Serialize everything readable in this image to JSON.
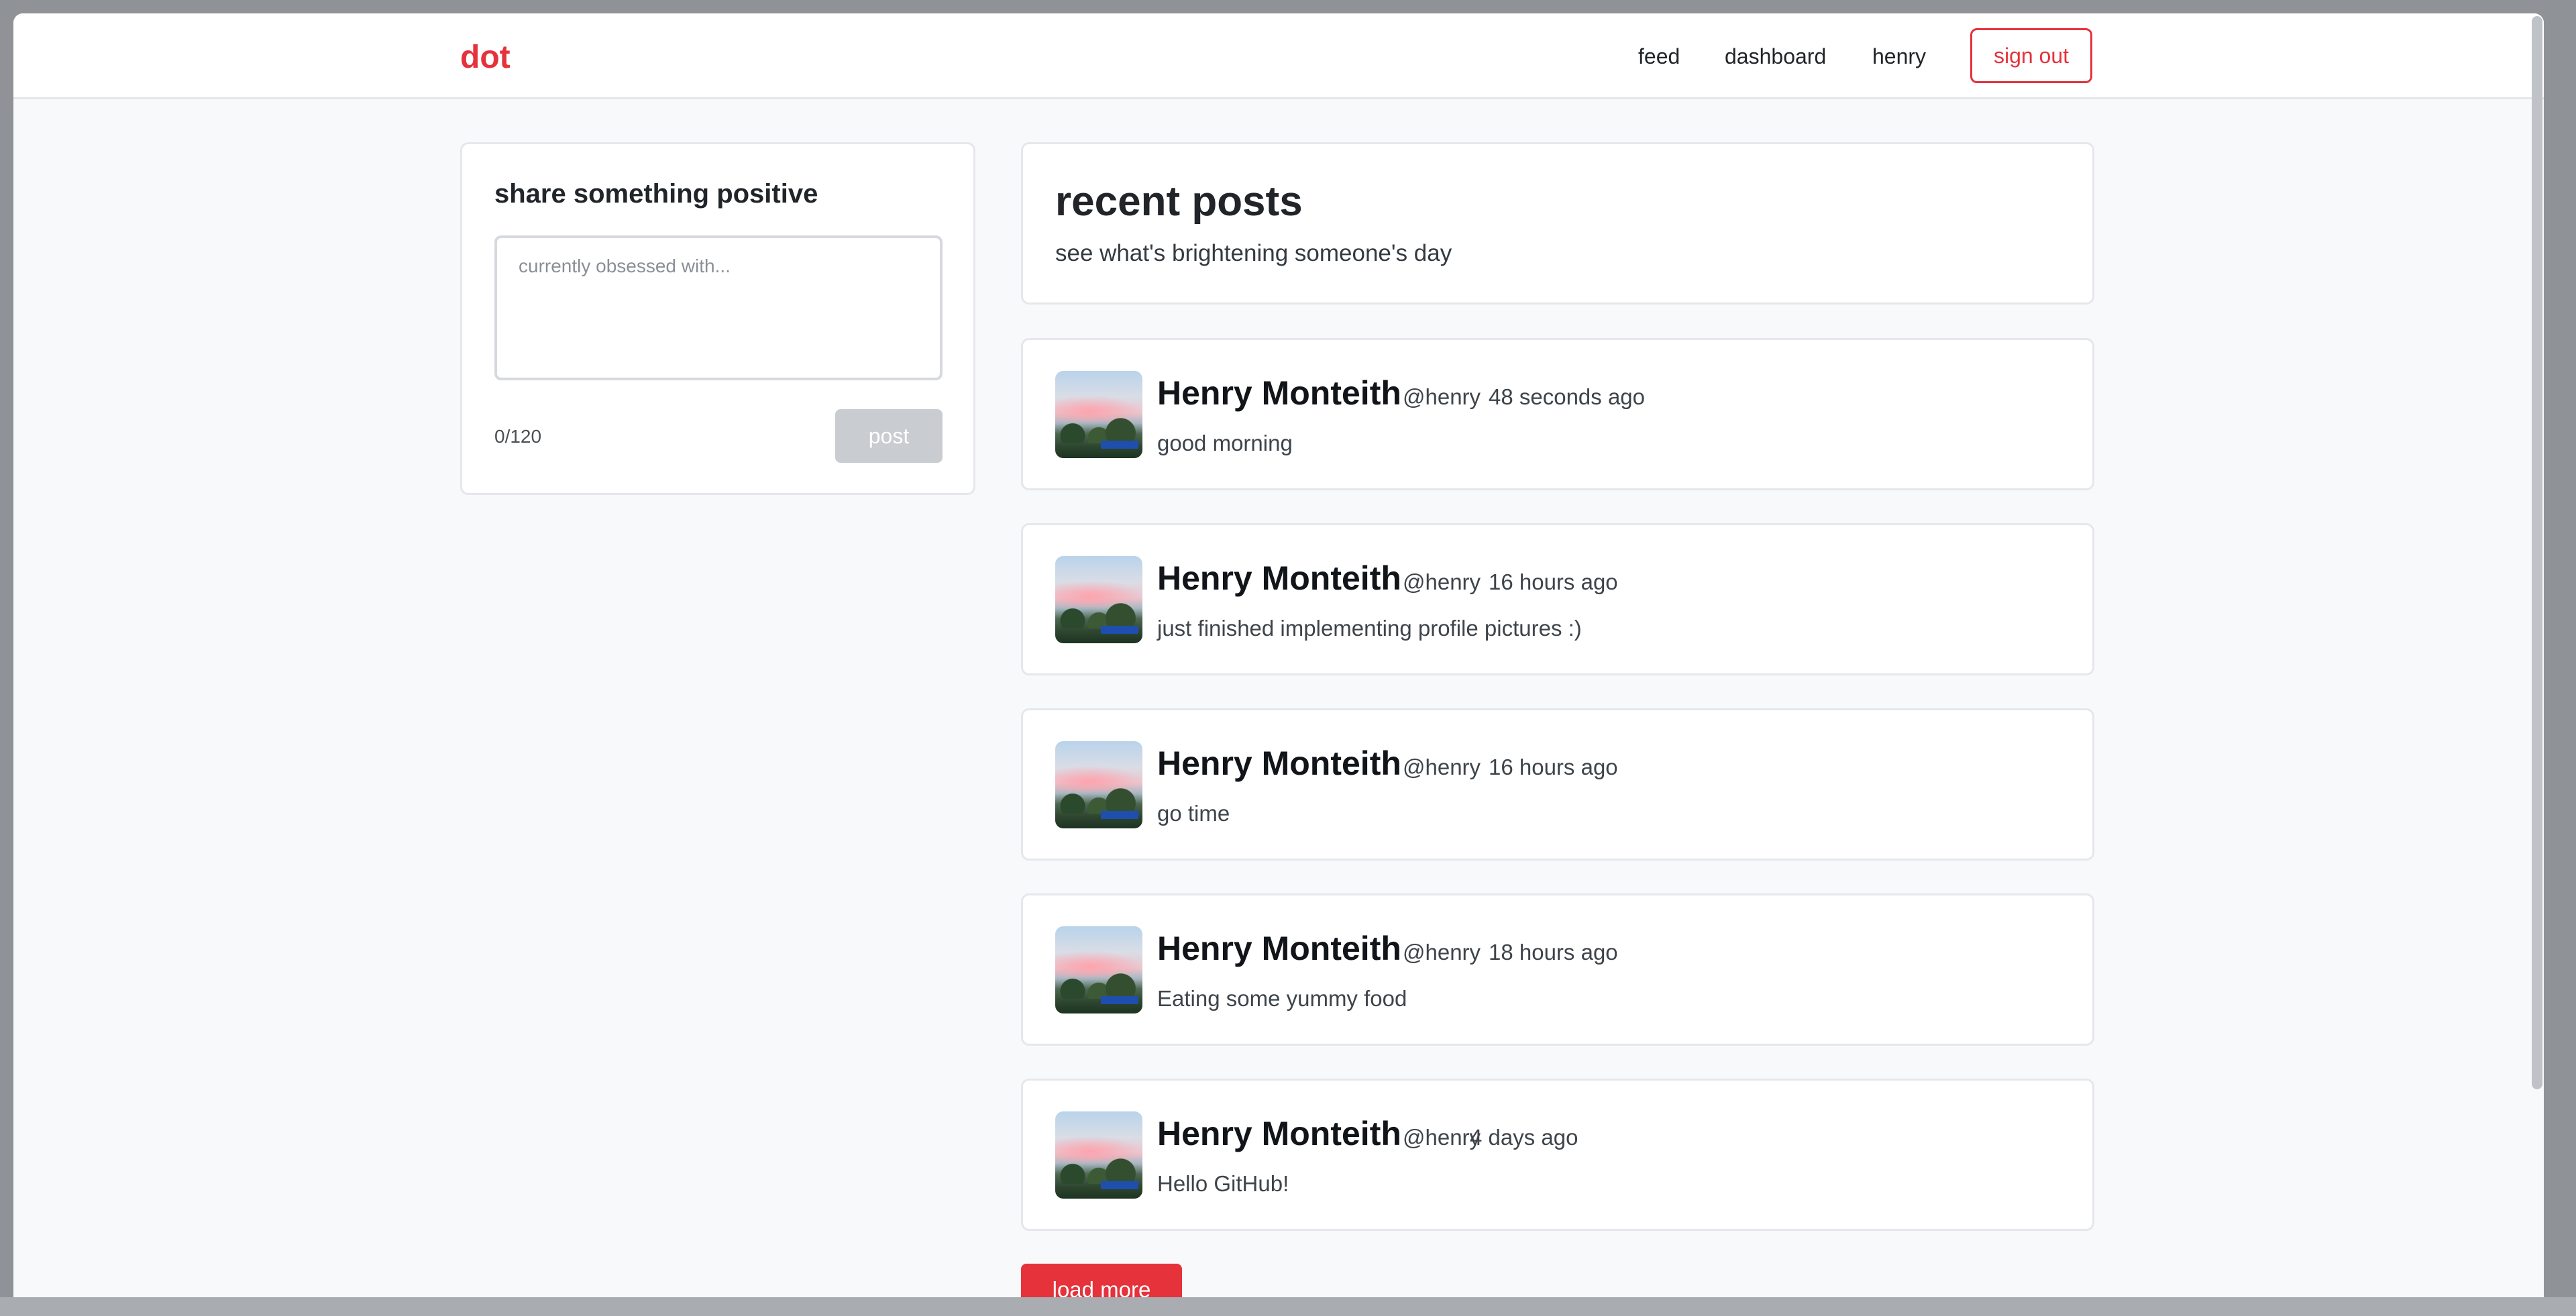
{
  "nav": {
    "brand": "dot",
    "links": [
      "feed",
      "dashboard",
      "henry"
    ],
    "sign_out": "sign out"
  },
  "compose": {
    "title": "share something positive",
    "placeholder": "currently obsessed with...",
    "counter": "0/120",
    "post_label": "post"
  },
  "feed_header": {
    "title": "recent posts",
    "subtitle": "see what's brightening someone's day"
  },
  "posts": [
    {
      "name": "Henry Monteith",
      "handle": "@henry",
      "time": "48 seconds ago",
      "body": "good morning"
    },
    {
      "name": "Henry Monteith",
      "handle": "@henry",
      "time": "16 hours ago",
      "body": "just finished implementing profile pictures :)"
    },
    {
      "name": "Henry Monteith",
      "handle": "@henry",
      "time": "16 hours ago",
      "body": "go time"
    },
    {
      "name": "Henry Monteith",
      "handle": "@henry",
      "time": "18 hours ago",
      "body": "Eating some yummy food"
    },
    {
      "name": "Henry Monteith",
      "handle": "@henry",
      "time": "4 days ago",
      "body": "Hello GitHub!"
    }
  ],
  "load_more": "load more",
  "colors": {
    "accent": "#e5323b",
    "page_bg": "#f8f9fa",
    "card_border": "#e5e7eb"
  }
}
